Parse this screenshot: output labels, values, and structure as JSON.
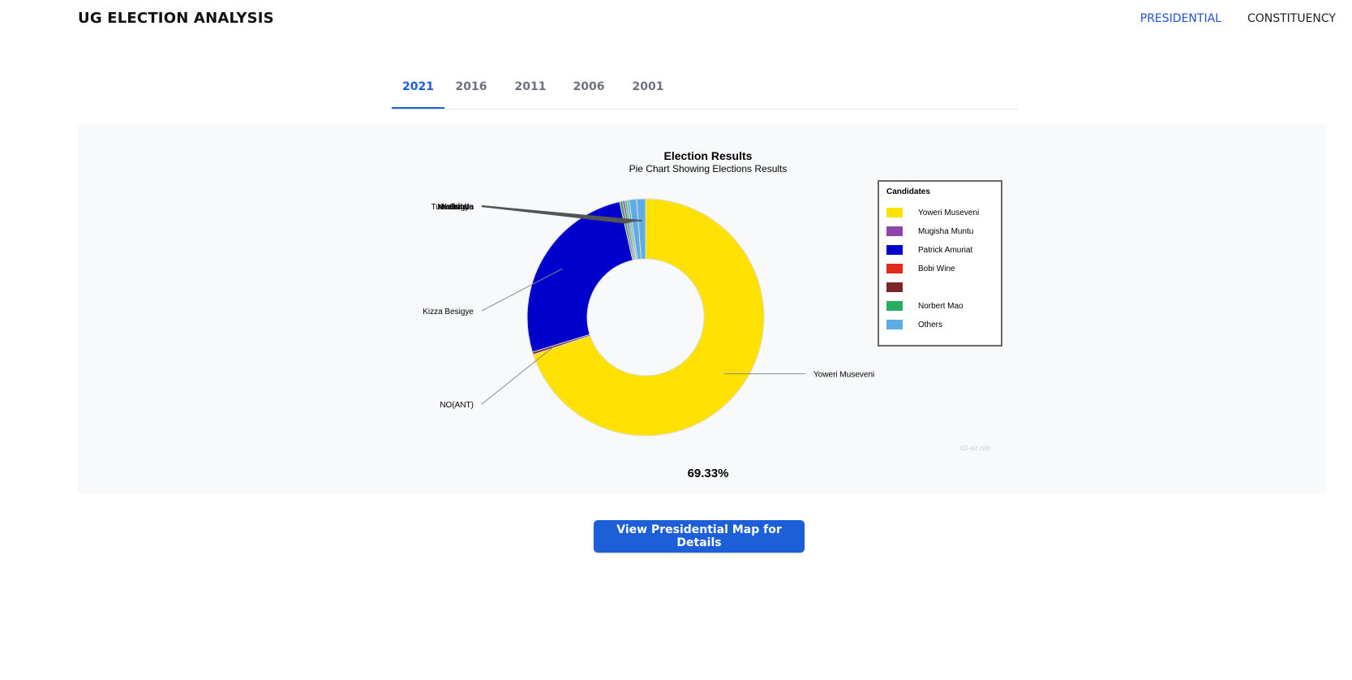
{
  "app": {
    "title": "UG ELECTION ANALYSIS"
  },
  "nav": {
    "items": [
      {
        "label": "PRESIDENTIAL",
        "active": true
      },
      {
        "label": "CONSTITUENCY",
        "active": false
      }
    ]
  },
  "tabs": [
    "2021",
    "2016",
    "2011",
    "2006",
    "2001"
  ],
  "active_tab": "2021",
  "chart_data": {
    "type": "pie",
    "title": "Election Results",
    "subtitle": "Pie Chart Showing Elections Results",
    "legend_title": "Candidates",
    "legend_position": "right",
    "slices": [
      {
        "label": "Yoweri Museveni",
        "value": 69.33,
        "color": "#FFE100"
      },
      {
        "label": "NO(ANT)",
        "value": 0.35,
        "color": "#7B2628"
      },
      {
        "label": "Kizza Besigye",
        "value": 26.01,
        "color": "#0000CC"
      },
      {
        "label": "Kasibante",
        "value": 0.4,
        "color": "#3DA35D"
      },
      {
        "label": "Kabuleta",
        "value": 0.3,
        "color": "#8E44AD"
      },
      {
        "label": "Mwesigye",
        "value": 0.3,
        "color": "#2ECC71"
      },
      {
        "label": "Tumukunde",
        "value": 0.3,
        "color": "#5DADE2"
      },
      {
        "label": "Kalembe",
        "value": 1.0,
        "color": "#5DADE2"
      },
      {
        "label": "Others",
        "value": 1.2,
        "color": "#5DADE2"
      }
    ],
    "legend": [
      {
        "label": "Yoweri Museveni",
        "color": "#FFE100"
      },
      {
        "label": "Mugisha Muntu",
        "color": "#8E44AD"
      },
      {
        "label": "Patrick Amuriat",
        "color": "#0000CC"
      },
      {
        "label": "Bobi Wine",
        "color": "#E02B20"
      },
      {
        "label": "",
        "color": "#7B2628"
      },
      {
        "label": "Norbert Mao",
        "color": "#27AE60"
      },
      {
        "label": "Others",
        "color": "#5DADE2"
      }
    ],
    "center_value": "69.33%",
    "watermark": "d3-ez.net"
  },
  "cta": {
    "label": "View Presidential Map for Details"
  }
}
